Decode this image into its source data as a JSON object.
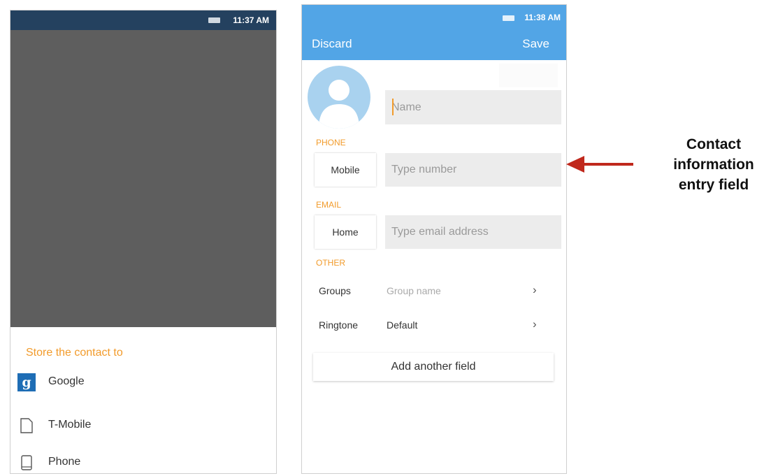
{
  "left_phone": {
    "status_time": "11:37 AM",
    "sheet_title": "Store the contact to",
    "options": [
      {
        "label": "Google",
        "icon": "google-icon"
      },
      {
        "label": "T-Mobile",
        "icon": "document-icon"
      },
      {
        "label": "Phone",
        "icon": "phone-icon"
      }
    ]
  },
  "right_phone": {
    "status_time": "11:38 AM",
    "discard_label": "Discard",
    "save_label": "Save",
    "name_placeholder": "Name",
    "phone_section": "PHONE",
    "phone_type": "Mobile",
    "phone_placeholder": "Type number",
    "email_section": "EMAIL",
    "email_type": "Home",
    "email_placeholder": "Type email address",
    "other_section": "OTHER",
    "groups_label": "Groups",
    "groups_value": "Group name",
    "ringtone_label": "Ringtone",
    "ringtone_value": "Default",
    "add_field_label": "Add another field"
  },
  "annotation": {
    "lines": [
      "Contact",
      "information",
      "entry field"
    ]
  },
  "colors": {
    "accent_orange": "#f29b2b",
    "appbar_blue": "#52a5e6",
    "status_dark": "#24415f",
    "arrow_red": "#c0281c"
  }
}
